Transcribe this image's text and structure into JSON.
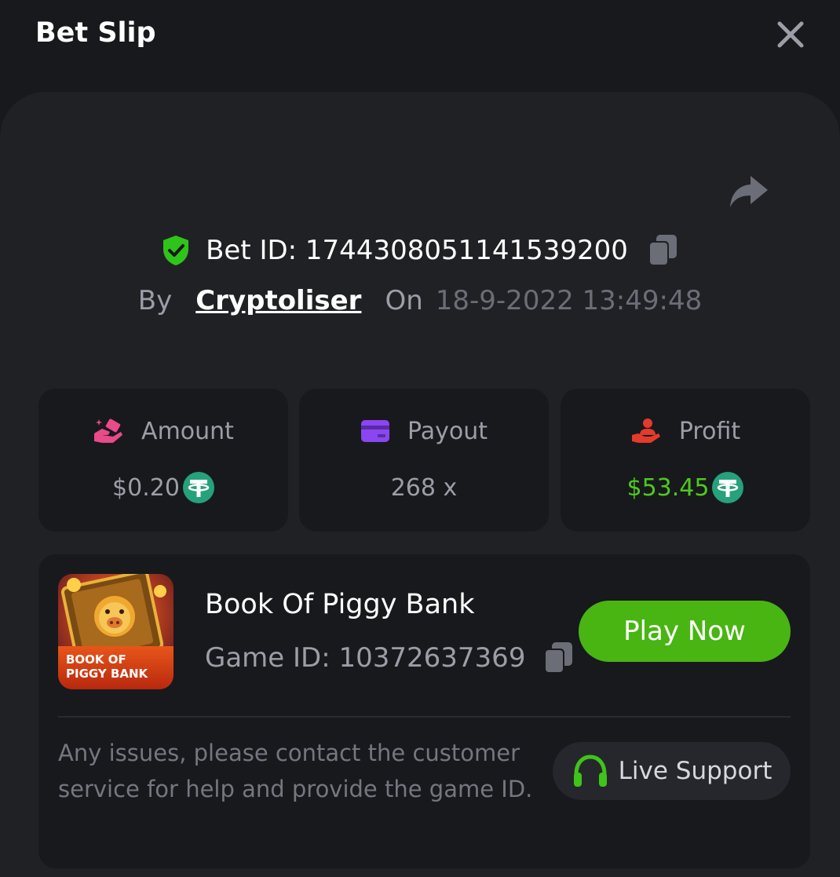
{
  "header": {
    "title": "Bet Slip"
  },
  "bet": {
    "id_label": "Bet ID: 1744308051141539200",
    "by_label": "By",
    "user": "Cryptoliser",
    "on_label": "On",
    "date": "18-9-2022 13:49:48"
  },
  "stats": [
    {
      "label": "Amount",
      "value": "$0.20",
      "icon": "coins-hand-icon",
      "currency_icon": "tether-icon"
    },
    {
      "label": "Payout",
      "value": "268 x",
      "icon": "card-icon"
    },
    {
      "label": "Profit",
      "value": "$53.45",
      "icon": "profit-hand-icon",
      "currency_icon": "tether-icon"
    }
  ],
  "game": {
    "name": "Book Of Piggy Bank",
    "id_label": "Game ID: 10372637369",
    "thumb_text_1": "BOOK OF",
    "thumb_text_2": "PIGGY BANK",
    "play_label": "Play Now"
  },
  "support": {
    "notice": "Any issues, please contact the customer service for help and provide the game ID.",
    "button_label": "Live Support"
  },
  "colors": {
    "background": "#18191d",
    "panel": "#202125",
    "accent_green": "#48b513",
    "profit_green": "#4ccb1c",
    "tether": "#26a17b",
    "shield": "#2fc419"
  }
}
